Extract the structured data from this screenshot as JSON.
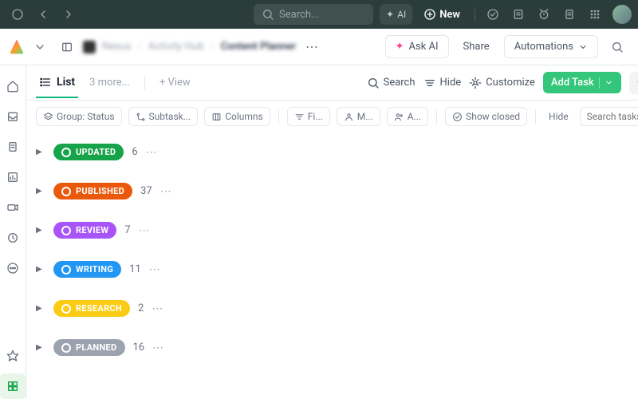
{
  "topbar": {
    "search_placeholder": "Search...",
    "ai_label": "AI",
    "new_label": "New"
  },
  "breadcrumb": {
    "item1": "Nexus",
    "item2": "Activity Hub",
    "item3": "Content Planner"
  },
  "subbar": {
    "ask_ai": "Ask AI",
    "share": "Share",
    "automations": "Automations"
  },
  "viewbar": {
    "list_label": "List",
    "more_label": "3 more...",
    "add_view": "+ View",
    "search": "Search",
    "hide": "Hide",
    "customize": "Customize",
    "add_task": "Add Task"
  },
  "filterbar": {
    "group": "Group: Status",
    "subtask": "Subtask...",
    "columns": "Columns",
    "filters": "Fi...",
    "me": "M...",
    "assignee": "A...",
    "show_closed": "Show closed",
    "hide": "Hide",
    "search_placeholder": "Search tasks"
  },
  "groups": [
    {
      "label": "UPDATED",
      "count": "6",
      "color": "#16a34a"
    },
    {
      "label": "PUBLISHED",
      "count": "37",
      "color": "#ea580c"
    },
    {
      "label": "REVIEW",
      "count": "7",
      "color": "#a855f7"
    },
    {
      "label": "WRITING",
      "count": "11",
      "color": "#2196f3"
    },
    {
      "label": "RESEARCH",
      "count": "2",
      "color": "#facc15"
    },
    {
      "label": "PLANNED",
      "count": "16",
      "color": "#9ca3af"
    }
  ]
}
